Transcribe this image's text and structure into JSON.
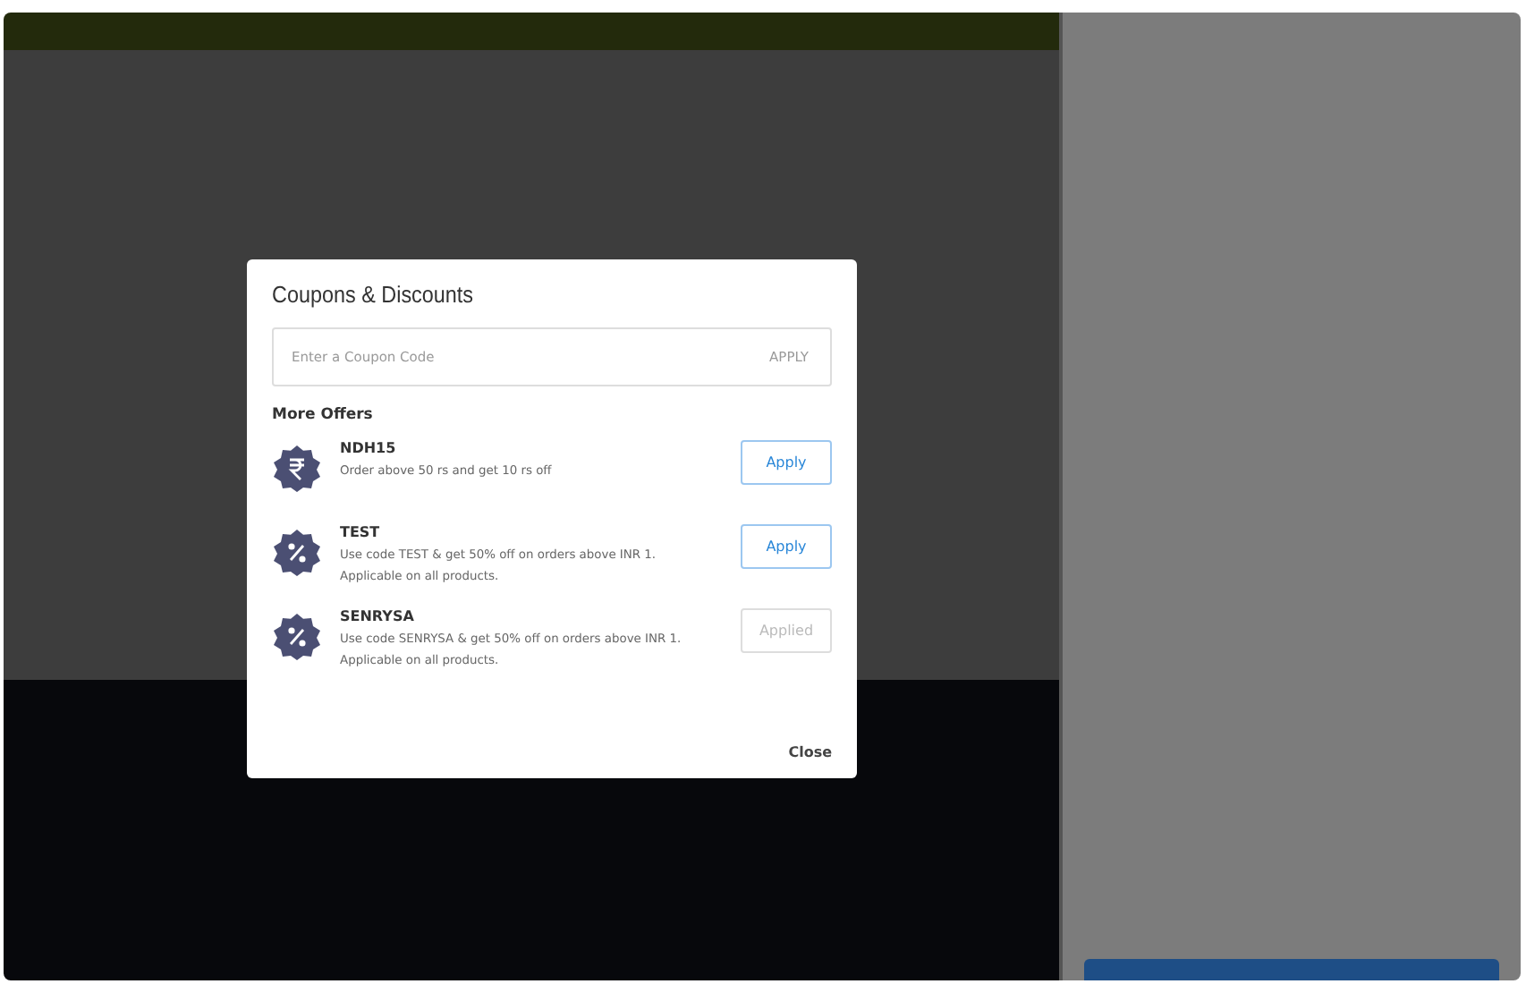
{
  "modal": {
    "title": "Coupons & Discounts",
    "coupon_field": {
      "placeholder": "Enter a Coupon Code",
      "action": "APPLY"
    },
    "section_title": "More Offers",
    "offers": [
      {
        "code": "NDH15",
        "kind": "rupee",
        "description": "Order above 50 rs and get 10 rs off",
        "button": "Apply",
        "applied": false
      },
      {
        "code": "TEST",
        "kind": "percent",
        "description": "Use code TEST & get 50% off on orders above INR 1. Applicable on all products.",
        "button": "Apply",
        "applied": false
      },
      {
        "code": "SENRYSA",
        "kind": "percent",
        "description": "Use code SENRYSA & get 50% off on orders above INR 1. Applicable on all products.",
        "button": "Applied",
        "applied": true
      }
    ],
    "close": "Close"
  }
}
